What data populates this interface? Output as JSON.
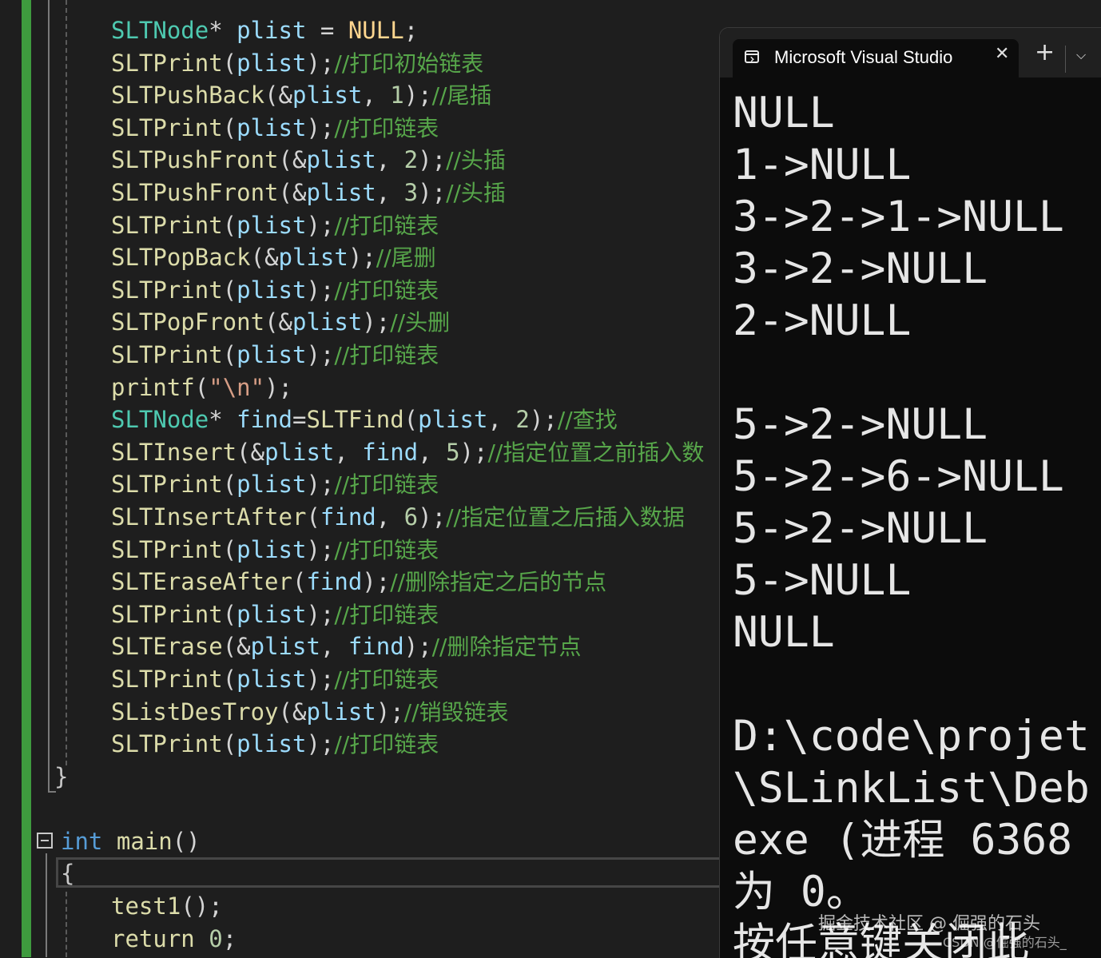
{
  "editor": {
    "lines": [
      {
        "tokens": [
          {
            "t": "SLTNode",
            "c": "t"
          },
          {
            "t": "* ",
            "c": "p"
          },
          {
            "t": "plist",
            "c": "v"
          },
          {
            "t": " = ",
            "c": "p"
          },
          {
            "t": "NULL",
            "c": "e"
          },
          {
            "t": ";",
            "c": "p"
          }
        ]
      },
      {
        "tokens": [
          {
            "t": "SLTPrint",
            "c": "f"
          },
          {
            "t": "(",
            "c": "p"
          },
          {
            "t": "plist",
            "c": "v"
          },
          {
            "t": ");",
            "c": "p"
          },
          {
            "t": "//打印初始链表",
            "c": "c"
          }
        ]
      },
      {
        "tokens": [
          {
            "t": "SLTPushBack",
            "c": "f"
          },
          {
            "t": "(&",
            "c": "p"
          },
          {
            "t": "plist",
            "c": "v"
          },
          {
            "t": ", ",
            "c": "p"
          },
          {
            "t": "1",
            "c": "n"
          },
          {
            "t": ");",
            "c": "p"
          },
          {
            "t": "//尾插",
            "c": "c"
          }
        ]
      },
      {
        "tokens": [
          {
            "t": "SLTPrint",
            "c": "f"
          },
          {
            "t": "(",
            "c": "p"
          },
          {
            "t": "plist",
            "c": "v"
          },
          {
            "t": ");",
            "c": "p"
          },
          {
            "t": "//打印链表",
            "c": "c"
          }
        ]
      },
      {
        "tokens": [
          {
            "t": "SLTPushFront",
            "c": "f"
          },
          {
            "t": "(&",
            "c": "p"
          },
          {
            "t": "plist",
            "c": "v"
          },
          {
            "t": ", ",
            "c": "p"
          },
          {
            "t": "2",
            "c": "n"
          },
          {
            "t": ");",
            "c": "p"
          },
          {
            "t": "//头插",
            "c": "c"
          }
        ]
      },
      {
        "tokens": [
          {
            "t": "SLTPushFront",
            "c": "f"
          },
          {
            "t": "(&",
            "c": "p"
          },
          {
            "t": "plist",
            "c": "v"
          },
          {
            "t": ", ",
            "c": "p"
          },
          {
            "t": "3",
            "c": "n"
          },
          {
            "t": ");",
            "c": "p"
          },
          {
            "t": "//头插",
            "c": "c"
          }
        ]
      },
      {
        "tokens": [
          {
            "t": "SLTPrint",
            "c": "f"
          },
          {
            "t": "(",
            "c": "p"
          },
          {
            "t": "plist",
            "c": "v"
          },
          {
            "t": ");",
            "c": "p"
          },
          {
            "t": "//打印链表",
            "c": "c"
          }
        ]
      },
      {
        "tokens": [
          {
            "t": "SLTPopBack",
            "c": "f"
          },
          {
            "t": "(&",
            "c": "p"
          },
          {
            "t": "plist",
            "c": "v"
          },
          {
            "t": ");",
            "c": "p"
          },
          {
            "t": "//尾删",
            "c": "c"
          }
        ]
      },
      {
        "tokens": [
          {
            "t": "SLTPrint",
            "c": "f"
          },
          {
            "t": "(",
            "c": "p"
          },
          {
            "t": "plist",
            "c": "v"
          },
          {
            "t": ");",
            "c": "p"
          },
          {
            "t": "//打印链表",
            "c": "c"
          }
        ]
      },
      {
        "tokens": [
          {
            "t": "SLTPopFront",
            "c": "f"
          },
          {
            "t": "(&",
            "c": "p"
          },
          {
            "t": "plist",
            "c": "v"
          },
          {
            "t": ");",
            "c": "p"
          },
          {
            "t": "//头删",
            "c": "c"
          }
        ]
      },
      {
        "tokens": [
          {
            "t": "SLTPrint",
            "c": "f"
          },
          {
            "t": "(",
            "c": "p"
          },
          {
            "t": "plist",
            "c": "v"
          },
          {
            "t": ");",
            "c": "p"
          },
          {
            "t": "//打印链表",
            "c": "c"
          }
        ]
      },
      {
        "tokens": [
          {
            "t": "printf",
            "c": "f"
          },
          {
            "t": "(",
            "c": "p"
          },
          {
            "t": "\"\\n\"",
            "c": "s"
          },
          {
            "t": ");",
            "c": "p"
          }
        ]
      },
      {
        "tokens": [
          {
            "t": "SLTNode",
            "c": "t"
          },
          {
            "t": "* ",
            "c": "p"
          },
          {
            "t": "find",
            "c": "v"
          },
          {
            "t": "=",
            "c": "p"
          },
          {
            "t": "SLTFind",
            "c": "f"
          },
          {
            "t": "(",
            "c": "p"
          },
          {
            "t": "plist",
            "c": "v"
          },
          {
            "t": ", ",
            "c": "p"
          },
          {
            "t": "2",
            "c": "n"
          },
          {
            "t": ");",
            "c": "p"
          },
          {
            "t": "//查找",
            "c": "c"
          }
        ]
      },
      {
        "tokens": [
          {
            "t": "SLTInsert",
            "c": "f"
          },
          {
            "t": "(&",
            "c": "p"
          },
          {
            "t": "plist",
            "c": "v"
          },
          {
            "t": ", ",
            "c": "p"
          },
          {
            "t": "find",
            "c": "v"
          },
          {
            "t": ", ",
            "c": "p"
          },
          {
            "t": "5",
            "c": "n"
          },
          {
            "t": ");",
            "c": "p"
          },
          {
            "t": "//指定位置之前插入数",
            "c": "c"
          }
        ]
      },
      {
        "tokens": [
          {
            "t": "SLTPrint",
            "c": "f"
          },
          {
            "t": "(",
            "c": "p"
          },
          {
            "t": "plist",
            "c": "v"
          },
          {
            "t": ");",
            "c": "p"
          },
          {
            "t": "//打印链表",
            "c": "c"
          }
        ]
      },
      {
        "tokens": [
          {
            "t": "SLTInsertAfter",
            "c": "f"
          },
          {
            "t": "(",
            "c": "p"
          },
          {
            "t": "find",
            "c": "v"
          },
          {
            "t": ", ",
            "c": "p"
          },
          {
            "t": "6",
            "c": "n"
          },
          {
            "t": ");",
            "c": "p"
          },
          {
            "t": "//指定位置之后插入数据",
            "c": "c"
          }
        ]
      },
      {
        "tokens": [
          {
            "t": "SLTPrint",
            "c": "f"
          },
          {
            "t": "(",
            "c": "p"
          },
          {
            "t": "plist",
            "c": "v"
          },
          {
            "t": ");",
            "c": "p"
          },
          {
            "t": "//打印链表",
            "c": "c"
          }
        ]
      },
      {
        "tokens": [
          {
            "t": "SLTEraseAfter",
            "c": "f"
          },
          {
            "t": "(",
            "c": "p"
          },
          {
            "t": "find",
            "c": "v"
          },
          {
            "t": ");",
            "c": "p"
          },
          {
            "t": "//删除指定之后的节点",
            "c": "c"
          }
        ]
      },
      {
        "tokens": [
          {
            "t": "SLTPrint",
            "c": "f"
          },
          {
            "t": "(",
            "c": "p"
          },
          {
            "t": "plist",
            "c": "v"
          },
          {
            "t": ");",
            "c": "p"
          },
          {
            "t": "//打印链表",
            "c": "c"
          }
        ]
      },
      {
        "tokens": [
          {
            "t": "SLTErase",
            "c": "f"
          },
          {
            "t": "(&",
            "c": "p"
          },
          {
            "t": "plist",
            "c": "v"
          },
          {
            "t": ", ",
            "c": "p"
          },
          {
            "t": "find",
            "c": "v"
          },
          {
            "t": ");",
            "c": "p"
          },
          {
            "t": "//删除指定节点",
            "c": "c"
          }
        ]
      },
      {
        "tokens": [
          {
            "t": "SLTPrint",
            "c": "f"
          },
          {
            "t": "(",
            "c": "p"
          },
          {
            "t": "plist",
            "c": "v"
          },
          {
            "t": ");",
            "c": "p"
          },
          {
            "t": "//打印链表",
            "c": "c"
          }
        ]
      },
      {
        "tokens": [
          {
            "t": "SListDesTroy",
            "c": "f"
          },
          {
            "t": "(&",
            "c": "p"
          },
          {
            "t": "plist",
            "c": "v"
          },
          {
            "t": ");",
            "c": "p"
          },
          {
            "t": "//销毁链表",
            "c": "c"
          }
        ]
      },
      {
        "tokens": [
          {
            "t": "SLTPrint",
            "c": "f"
          },
          {
            "t": "(",
            "c": "p"
          },
          {
            "t": "plist",
            "c": "v"
          },
          {
            "t": ");",
            "c": "p"
          },
          {
            "t": "//打印链表",
            "c": "c"
          }
        ]
      },
      {
        "tokens": [
          {
            "t": "}",
            "c": "m"
          }
        ]
      },
      {
        "tokens": []
      },
      {
        "tokens": [
          {
            "t": "int",
            "c": "k"
          },
          {
            "t": " ",
            "c": "p"
          },
          {
            "t": "main",
            "c": "f"
          },
          {
            "t": "()",
            "c": "p"
          }
        ]
      },
      {
        "tokens": [
          {
            "t": "{",
            "c": "m"
          }
        ]
      },
      {
        "tokens": [
          {
            "t": "test1",
            "c": "f"
          },
          {
            "t": "();",
            "c": "p"
          }
        ]
      },
      {
        "tokens": [
          {
            "t": "return",
            "c": "f"
          },
          {
            "t": " ",
            "c": "p"
          },
          {
            "t": "0",
            "c": "n"
          },
          {
            "t": ";",
            "c": "p"
          }
        ]
      }
    ]
  },
  "terminal": {
    "tab_title": "Microsoft Visual Studio",
    "close_glyph": "✕",
    "new_tab_glyph": "+",
    "dropdown_glyph": "⌵",
    "icon": "terminal-icon",
    "output": [
      "NULL",
      "1->NULL",
      "3->2->1->NULL",
      "3->2->NULL",
      "2->NULL",
      "",
      "5->2->NULL",
      "5->2->6->NULL",
      "5->2->NULL",
      "5->NULL",
      "NULL",
      "",
      "D:\\code\\projet",
      "\\SLinkList\\Deb",
      "exe (进程 6368",
      "为 0。",
      "按任意键关闭此"
    ]
  },
  "watermark": {
    "line1": "掘金技术社区 @ 倔强的石头",
    "line2": "CSDN @倔强的石头_"
  },
  "colors": {
    "editor_bg": "#1e1e1e",
    "function": "#dcdcaa",
    "type": "#4ec9b0",
    "variable": "#9cdcfe",
    "keyword": "#569cd6",
    "number": "#b5cea8",
    "comment": "#57a64a",
    "string": "#d69d85",
    "macro": "#ffd68f",
    "terminal_bg": "#0c0c0c",
    "change_bar": "#3e9b3e"
  }
}
